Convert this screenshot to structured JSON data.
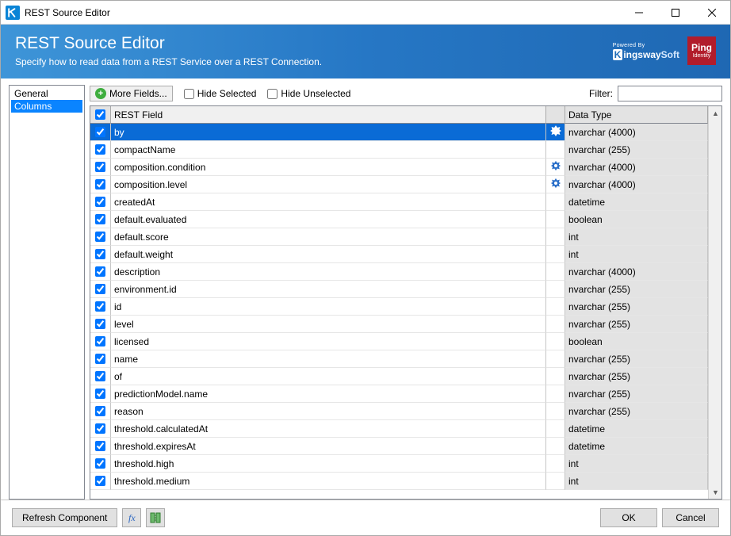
{
  "window": {
    "title": "REST Source Editor"
  },
  "header": {
    "title": "REST Source Editor",
    "subtitle": "Specify how to read data from a REST Service over a REST Connection.",
    "powered_by": "Powered By",
    "kingsway": "KingswaySoft",
    "ping1": "Ping",
    "ping2": "Identity"
  },
  "sidebar": {
    "tabs": [
      {
        "label": "General"
      },
      {
        "label": "Columns"
      }
    ]
  },
  "toolbar": {
    "more_fields": "More Fields...",
    "hide_selected": "Hide Selected",
    "hide_unselected": "Hide Unselected",
    "filter_label": "Filter:",
    "filter_value": ""
  },
  "grid": {
    "headers": {
      "field": "REST Field",
      "type": "Data Type"
    },
    "rows": [
      {
        "field": "by",
        "type": "nvarchar (4000)",
        "gear": true,
        "selected": true
      },
      {
        "field": "compactName",
        "type": "nvarchar (255)",
        "gear": false
      },
      {
        "field": "composition.condition",
        "type": "nvarchar (4000)",
        "gear": true
      },
      {
        "field": "composition.level",
        "type": "nvarchar (4000)",
        "gear": true
      },
      {
        "field": "createdAt",
        "type": "datetime",
        "gear": false
      },
      {
        "field": "default.evaluated",
        "type": "boolean",
        "gear": false
      },
      {
        "field": "default.score",
        "type": "int",
        "gear": false
      },
      {
        "field": "default.weight",
        "type": "int",
        "gear": false
      },
      {
        "field": "description",
        "type": "nvarchar (4000)",
        "gear": false
      },
      {
        "field": "environment.id",
        "type": "nvarchar (255)",
        "gear": false
      },
      {
        "field": "id",
        "type": "nvarchar (255)",
        "gear": false
      },
      {
        "field": "level",
        "type": "nvarchar (255)",
        "gear": false
      },
      {
        "field": "licensed",
        "type": "boolean",
        "gear": false
      },
      {
        "field": "name",
        "type": "nvarchar (255)",
        "gear": false
      },
      {
        "field": "of",
        "type": "nvarchar (255)",
        "gear": false
      },
      {
        "field": "predictionModel.name",
        "type": "nvarchar (255)",
        "gear": false
      },
      {
        "field": "reason",
        "type": "nvarchar (255)",
        "gear": false
      },
      {
        "field": "threshold.calculatedAt",
        "type": "datetime",
        "gear": false
      },
      {
        "field": "threshold.expiresAt",
        "type": "datetime",
        "gear": false
      },
      {
        "field": "threshold.high",
        "type": "int",
        "gear": false
      },
      {
        "field": "threshold.medium",
        "type": "int",
        "gear": false
      }
    ]
  },
  "footer": {
    "refresh": "Refresh Component",
    "ok": "OK",
    "cancel": "Cancel"
  }
}
